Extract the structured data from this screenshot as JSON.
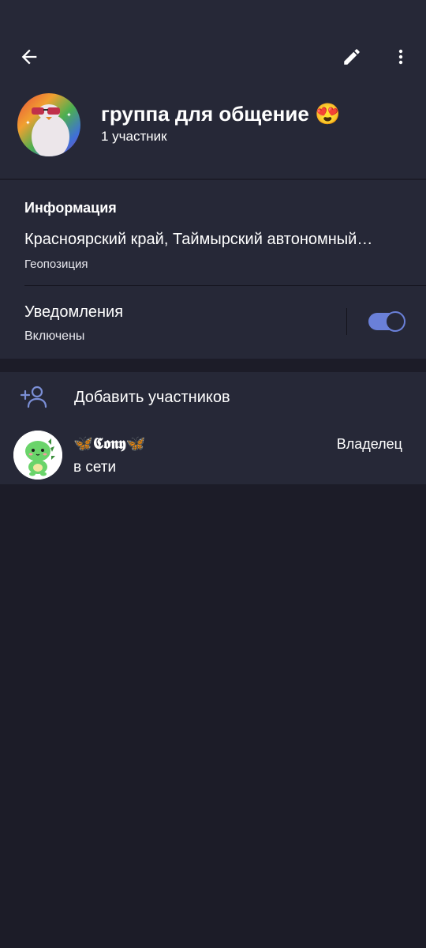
{
  "header": {
    "title": "группа для общение 😍",
    "subtitle": "1 участник",
    "back_icon": "arrow-left-icon",
    "edit_icon": "pencil-icon",
    "more_icon": "more-vertical-icon"
  },
  "info": {
    "heading": "Информация",
    "location": "Красноярский край, Таймырский автономный…",
    "location_label": "Геопозиция"
  },
  "notifications": {
    "title": "Уведомления",
    "status": "Включены",
    "enabled": true
  },
  "members": {
    "add_label": "Добавить участников",
    "add_icon": "add-user-icon",
    "list": [
      {
        "name": "🦋𝕮𝖔𝖓𝖞🦋",
        "status": "в сети",
        "role": "Владелец"
      }
    ]
  },
  "colors": {
    "background": "#1c1c28",
    "panel": "#262837",
    "accent": "#6a80d8",
    "icon_accent": "#7b8fd6"
  }
}
